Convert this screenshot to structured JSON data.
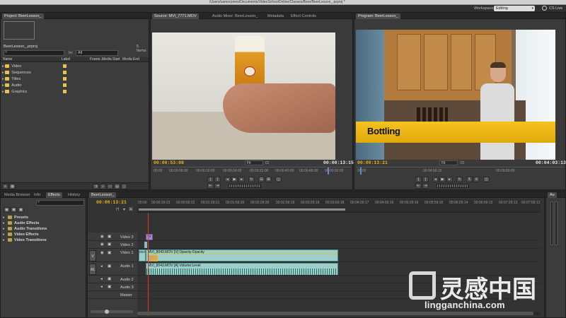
{
  "window": {
    "path": "/Users/samorjones/Documents/VideoSchoolOnline/Classes/Beer/BeerLesson_.prproj *",
    "workspace_label": "Workspace:",
    "workspace_value": "Editing",
    "cslive": "CS Live"
  },
  "project": {
    "tab": "Project: BeerLesson_",
    "name": "BeerLesson_.prproj",
    "count": "5 Items",
    "in_label": "In:",
    "in_value": "All",
    "columns": [
      "Name",
      "Label",
      "Frame...",
      "Media Start",
      "Media End"
    ],
    "items": [
      "Video",
      "Sequences",
      "Titles",
      "Audio",
      "Graphics"
    ]
  },
  "source": {
    "tabs": [
      "Source: MVI_7771.MOV",
      "Audio Mixer: BeerLesson_",
      "Metadata",
      "Effect Controls"
    ],
    "tc_left": "00:00:53:08",
    "tc_right": "00:00:13:15",
    "fit": "Fit",
    "ruler": [
      "00:00",
      "00:00:08:00",
      "00:00:16:00",
      "00:00:24:00",
      "00:00:32:00",
      "00:00:40:00",
      "00:00:48:00",
      "00:00:56:00"
    ]
  },
  "program": {
    "tab": "Program: BeerLesson_",
    "tc_left": "00:00:13:21",
    "tc_right": "00:04:03:13",
    "fit": "Fit",
    "title_overlay": "Bottling",
    "ruler": [
      "00:00",
      "00:04:59:16",
      "00:09:59:09"
    ]
  },
  "effects": {
    "tabs": [
      "Media Browser",
      "Info",
      "Effects",
      "History"
    ],
    "items": [
      "Presets",
      "Audio Effects",
      "Audio Transitions",
      "Video Effects",
      "Video Transitions"
    ]
  },
  "timeline": {
    "tab": "BeerLesson_",
    "tc": "00:00:13:21",
    "ruler": [
      "00:00",
      "00:00:29:23",
      "00:00:59:22",
      "00:01:29:21",
      "00:01:59:20",
      "00:02:29:20",
      "00:02:59:19",
      "00:03:29:18",
      "00:03:59:18",
      "00:04:29:17",
      "00:04:59:16",
      "00:05:29:16",
      "00:05:59:15",
      "00:06:29:14",
      "00:06:59:13",
      "00:07:29:13",
      "00:07:59:12"
    ],
    "tracks": [
      "Video 3",
      "Video 2",
      "Video 1",
      "Audio 1",
      "Audio 2",
      "Audio 3",
      "Master"
    ],
    "v_target": "V",
    "a_target": "A1",
    "clip_video": "MVI_8043.MOV [V] Opacity:Opacity",
    "clip_audio": "MVI_8043.MOV [A] Volume:Level",
    "clip_v1_small": "MVI",
    "clip_v3": "Tit"
  },
  "audio_meter": {
    "label": "Au"
  },
  "watermark": {
    "text": "灵感中国",
    "url": "lingganchina.com"
  }
}
